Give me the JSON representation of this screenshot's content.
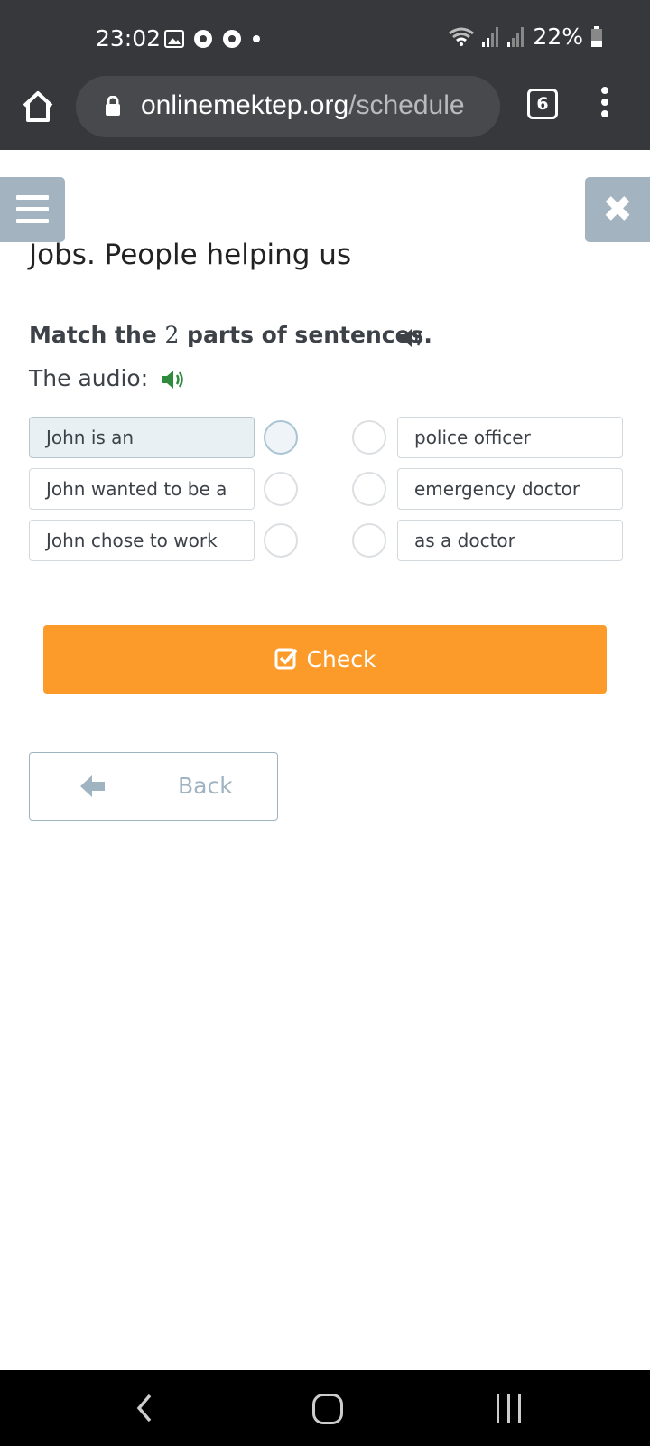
{
  "status_bar": {
    "time": "23:02",
    "battery": "22%"
  },
  "browser": {
    "url_host": "onlinemektep.org",
    "url_path": "/schedule",
    "tab_count": "6"
  },
  "page": {
    "title": "Jobs. People helping us",
    "instruction_prefix": "Match the ",
    "instruction_number": "2",
    "instruction_suffix": " parts of sentences.",
    "audio_label": "The audio:"
  },
  "match": {
    "left": [
      {
        "text": "John is an",
        "selected": true
      },
      {
        "text": "John wanted to be a",
        "selected": false
      },
      {
        "text": "John chose to work",
        "selected": false
      }
    ],
    "right": [
      {
        "text": "police officer"
      },
      {
        "text": "emergency doctor"
      },
      {
        "text": "as a doctor"
      }
    ]
  },
  "buttons": {
    "check": "Check",
    "back": "Back"
  },
  "colors": {
    "status_bg": "#36383b",
    "accent_orange": "#fd9b2a",
    "side_button": "#a3b3bf",
    "audio_green": "#2e8b3e",
    "selected_bg": "#e8f0f4"
  },
  "icons": {
    "home": "home-icon",
    "lock": "lock-icon",
    "menu": "more-vert-icon",
    "hamburger": "hamburger-icon",
    "close": "close-icon",
    "speaker": "speaker-icon",
    "check": "checkbox-icon",
    "back": "arrow-left-icon"
  }
}
